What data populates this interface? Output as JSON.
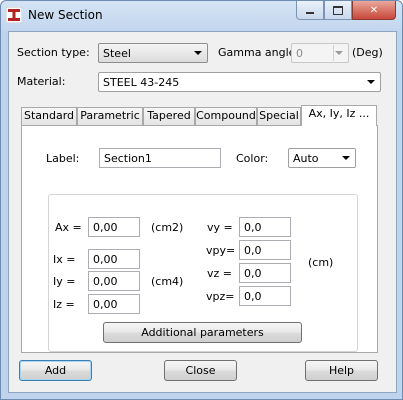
{
  "window": {
    "title": "New Section",
    "icon": "section-i-beam-icon"
  },
  "caption": {
    "minimize": "minimize-icon",
    "maximize": "maximize-icon",
    "close": "close-icon"
  },
  "top": {
    "section_type_label": "Section type:",
    "section_type_value": "Steel",
    "gamma_label": "Gamma angle:",
    "gamma_value": "0",
    "gamma_unit": "(Deg)",
    "material_label": "Material:",
    "material_value": "STEEL 43-245"
  },
  "tabs": [
    {
      "label": "Standard",
      "active": false
    },
    {
      "label": "Parametric",
      "active": false
    },
    {
      "label": "Tapered",
      "active": false
    },
    {
      "label": "Compound",
      "active": false
    },
    {
      "label": "Special",
      "active": false
    },
    {
      "label": "Ax, Iy, Iz ...",
      "active": true
    }
  ],
  "panel": {
    "label_caption": "Label:",
    "label_value": "Section1",
    "color_caption": "Color:",
    "color_value": "Auto",
    "ax_label": "Ax =",
    "ax_value": "0,00",
    "ax_unit": "(cm2)",
    "ix_label": "Ix =",
    "ix_value": "0,00",
    "iy_label": "Iy =",
    "iy_value": "0,00",
    "iz_label": "Iz =",
    "iz_value": "0,00",
    "inertia_unit": "(cm4)",
    "vy_label": "vy =",
    "vy_value": "0,0",
    "vpy_label": "vpy=",
    "vpy_value": "0,0",
    "vz_label": "vz =",
    "vz_value": "0,0",
    "vpz_label": "vpz=",
    "vpz_value": "0,0",
    "v_unit": "(cm)",
    "additional_button": "Additional parameters"
  },
  "buttons": {
    "add": "Add",
    "close": "Close",
    "help": "Help"
  },
  "colors": {
    "title_bg": "#c2d6ee",
    "close_btn": "#c8473a",
    "default_btn_border": "#3c7fb1"
  }
}
